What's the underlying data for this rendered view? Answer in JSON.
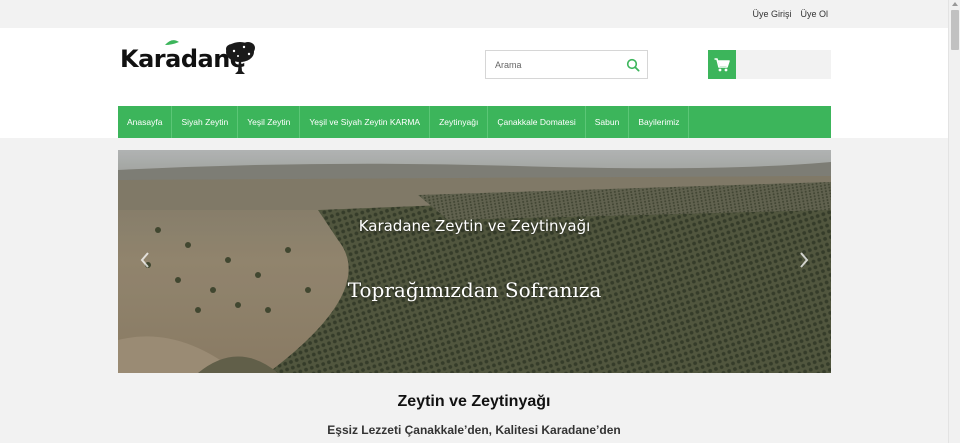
{
  "topbar": {
    "login_label": "Üye Girişi",
    "register_label": "Üye Ol"
  },
  "logo": {
    "text": "Karadane",
    "icon": "olive-tree-icon"
  },
  "search": {
    "placeholder": "Arama",
    "icon": "search-icon"
  },
  "cart": {
    "icon": "shopping-cart-icon"
  },
  "nav": {
    "items": [
      {
        "label": "Anasayfa"
      },
      {
        "label": "Siyah Zeytin"
      },
      {
        "label": "Yeşil Zeytin"
      },
      {
        "label": "Yeşil ve Siyah Zeytin KARMA"
      },
      {
        "label": "Zeytinyağı"
      },
      {
        "label": "Çanakkale Domatesi"
      },
      {
        "label": "Sabun"
      },
      {
        "label": "Bayilerimiz"
      }
    ]
  },
  "slider": {
    "title": "Karadane Zeytin ve Zeytinyağı",
    "subtitle": "Toprağımızdan Sofranıza",
    "prev_icon": "chevron-left-icon",
    "next_icon": "chevron-right-icon"
  },
  "section": {
    "title": "Zeytin ve Zeytinyağı",
    "subtitle": "Eşsiz Lezzeti Çanakkale’den, Kalitesi Karadane’den"
  },
  "colors": {
    "accent": "#3cb55b",
    "header_bg": "#ffffff",
    "page_bg": "#f2f2f2"
  }
}
